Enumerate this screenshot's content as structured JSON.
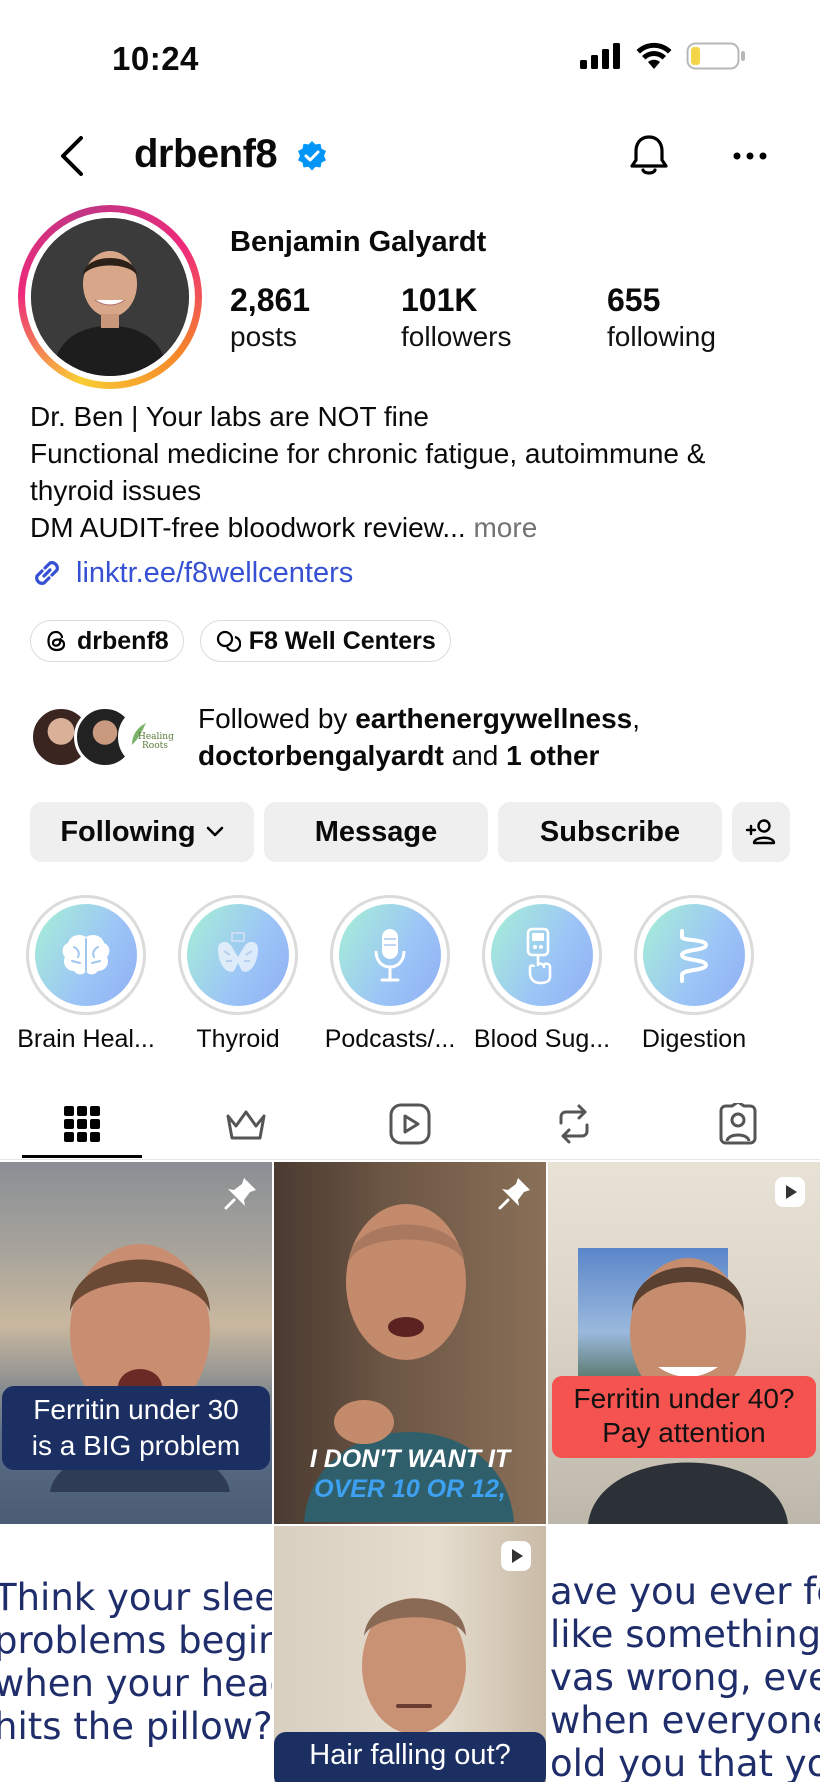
{
  "status_bar": {
    "time": "10:24"
  },
  "header": {
    "username": "drbenf8"
  },
  "profile": {
    "display_name": "Benjamin Galyardt",
    "stats": [
      {
        "value": "2,861",
        "label": "posts"
      },
      {
        "value": "101K",
        "label": "followers"
      },
      {
        "value": "655",
        "label": "following"
      }
    ],
    "bio_lines": [
      "Dr. Ben | Your labs are NOT fine",
      "Functional medicine for chronic fatigue, autoimmune &",
      "thyroid issues",
      "DM AUDIT-free bloodwork review..."
    ],
    "bio_more": "more",
    "link": "linktr.ee/f8wellcenters",
    "chips": [
      {
        "label": "drbenf8",
        "icon": "threads-icon"
      },
      {
        "label": "F8 Well Centers",
        "icon": "chat-icon"
      }
    ],
    "followed_by": {
      "prefix": "Followed by ",
      "user1": "earthenergywellness",
      "comma": ",",
      "user2": "doctorbengalyardt",
      "and": " and ",
      "other": "1 other"
    }
  },
  "actions": {
    "following": "Following",
    "message": "Message",
    "subscribe": "Subscribe"
  },
  "highlights": [
    {
      "label": "Brain Heal...",
      "icon": "brain-icon"
    },
    {
      "label": "Thyroid",
      "icon": "thyroid-icon"
    },
    {
      "label": "Podcasts/...",
      "icon": "microphone-icon"
    },
    {
      "label": "Blood Sug...",
      "icon": "glucometer-icon"
    },
    {
      "label": "Digestion",
      "icon": "intestine-icon"
    }
  ],
  "tabs": [
    {
      "name": "grid-icon",
      "active": true
    },
    {
      "name": "crown-icon",
      "active": false
    },
    {
      "name": "reels-icon",
      "active": false
    },
    {
      "name": "repost-icon",
      "active": false
    },
    {
      "name": "tagged-icon",
      "active": false
    }
  ],
  "posts": {
    "p1": {
      "line1": "Ferritin under 30",
      "line2": "is a BIG problem"
    },
    "p2": {
      "line1": "I DON'T WANT IT",
      "line2": "OVER 10 OR 12,"
    },
    "p3": {
      "line1": "Ferritin under 40?",
      "line2": "Pay attention"
    },
    "p4": {
      "text": "Think your sleep\nproblems begin\nwhen your head\nhits the pillow?"
    },
    "p5": {
      "caption": "Hair falling out?"
    },
    "p6": {
      "text": "ave you ever fe\nlike something\nvas wrong, even\nwhen everyone\nold you that yo"
    }
  }
}
